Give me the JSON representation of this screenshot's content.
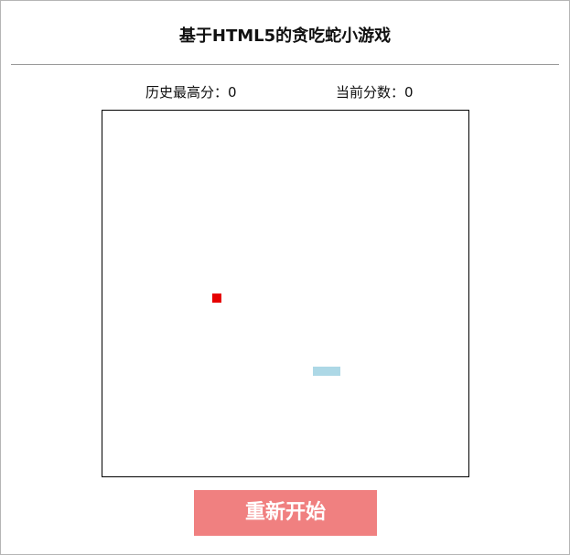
{
  "header": {
    "title": "基于HTML5的贪吃蛇小游戏"
  },
  "scores": {
    "best_label": "历史最高分：",
    "best_value": "0",
    "current_label": "当前分数：",
    "current_value": "0"
  },
  "game": {
    "grid_size": 40,
    "food": {
      "col": 12,
      "row": 20,
      "color": "#e60000"
    },
    "snake": {
      "color": "#add8e6",
      "segments": [
        {
          "col": 23,
          "row": 28
        },
        {
          "col": 24,
          "row": 28
        },
        {
          "col": 25,
          "row": 28
        }
      ]
    }
  },
  "controls": {
    "restart_label": "重新开始",
    "restart_color": "#f08080"
  }
}
